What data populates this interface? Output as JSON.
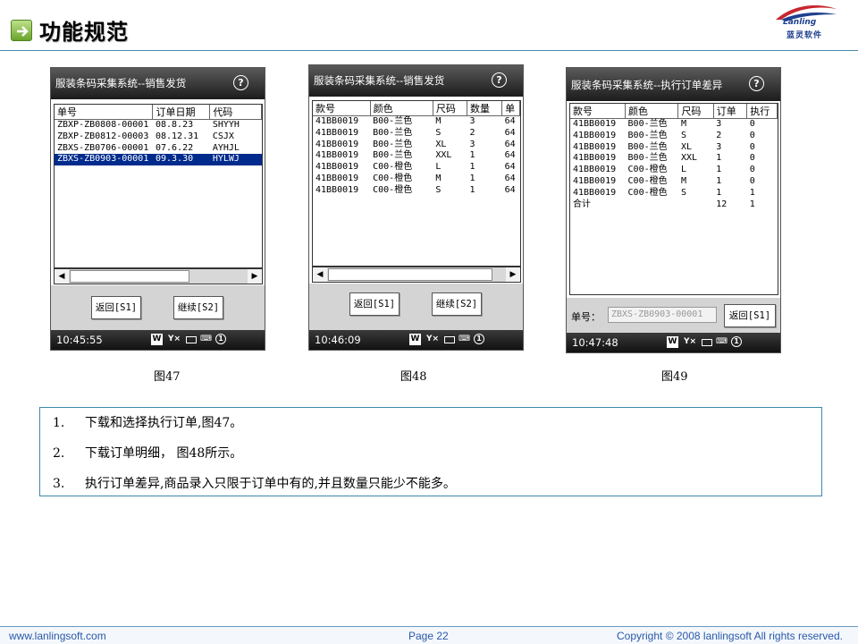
{
  "slide": {
    "title": "功能规范",
    "logo_text": "Lanling",
    "logo_subtext": "蓝灵软件"
  },
  "screens": [
    {
      "window_title": "服装条码采集系统--销售发货",
      "columns": [
        "单号",
        "订单日期",
        "代码"
      ],
      "rows": [
        [
          "ZBXP-ZB0808-00001",
          "08.8.23",
          "SHYYH"
        ],
        [
          "ZBXP-ZB0812-00003",
          "08.12.31",
          "CSJX"
        ],
        [
          "ZBXS-ZB0706-00001",
          "07.6.22",
          "AYHJL"
        ],
        [
          "ZBXS-ZB0903-00001",
          "09.3.30",
          "HYLWJ"
        ]
      ],
      "selected_row": 3,
      "buttons": [
        "返回[S1]",
        "继续[S2]"
      ],
      "time": "10:45:55",
      "caption": "图47"
    },
    {
      "window_title": "服装条码采集系统--销售发货",
      "columns": [
        "款号",
        "颜色",
        "尺码",
        "数量",
        "单"
      ],
      "rows": [
        [
          "41BB0019",
          "B00-兰色",
          "M",
          "3",
          "64"
        ],
        [
          "41BB0019",
          "B00-兰色",
          "S",
          "2",
          "64"
        ],
        [
          "41BB0019",
          "B00-兰色",
          "XL",
          "3",
          "64"
        ],
        [
          "41BB0019",
          "B00-兰色",
          "XXL",
          "1",
          "64"
        ],
        [
          "41BB0019",
          "C00-橙色",
          "L",
          "1",
          "64"
        ],
        [
          "41BB0019",
          "C00-橙色",
          "M",
          "1",
          "64"
        ],
        [
          "41BB0019",
          "C00-橙色",
          "S",
          "1",
          "64"
        ]
      ],
      "buttons": [
        "返回[S1]",
        "继续[S2]"
      ],
      "time": "10:46:09",
      "caption": "图48"
    },
    {
      "window_title": "服装条码采集系统--执行订单差异",
      "columns": [
        "款号",
        "颜色",
        "尺码",
        "订单",
        "执行"
      ],
      "rows": [
        [
          "41BB0019",
          "B00-兰色",
          "M",
          "3",
          "0"
        ],
        [
          "41BB0019",
          "B00-兰色",
          "S",
          "2",
          "0"
        ],
        [
          "41BB0019",
          "B00-兰色",
          "XL",
          "3",
          "0"
        ],
        [
          "41BB0019",
          "B00-兰色",
          "XXL",
          "1",
          "0"
        ],
        [
          "41BB0019",
          "C00-橙色",
          "L",
          "1",
          "0"
        ],
        [
          "41BB0019",
          "C00-橙色",
          "M",
          "1",
          "0"
        ],
        [
          "41BB0019",
          "C00-橙色",
          "S",
          "1",
          "1"
        ],
        [
          "合计",
          "",
          "",
          "12",
          "1"
        ]
      ],
      "order_label": "单号：",
      "order_value": "ZBXS-ZB0903-00001",
      "buttons": [
        "返回[S1]"
      ],
      "time": "10:47:48",
      "caption": "图49"
    }
  ],
  "status_icons": [
    "windows-icon",
    "signal-off-icon",
    "battery-icon",
    "keyboard-icon",
    "notification-icon"
  ],
  "status_icon_glyphs": [
    "W",
    "Y×",
    "▭",
    "⌨",
    "1"
  ],
  "notes": [
    {
      "num": "1.",
      "text": "下载和选择执行订单,图47。"
    },
    {
      "num": "2.",
      "text": "下载订单明细， 图48所示。"
    },
    {
      "num": "3.",
      "text": "执行订单差异,商品录入只限于订单中有的,并且数量只能少不能多。"
    }
  ],
  "footer": {
    "website": "www.lanlingsoft.com",
    "page": "Page 22",
    "copyright": "Copyright © 2008 lanlingsoft All rights reserved."
  },
  "colors": {
    "accent": "#3c8aa8",
    "selection": "#002b8c",
    "footer_text": "#2a58a8"
  }
}
